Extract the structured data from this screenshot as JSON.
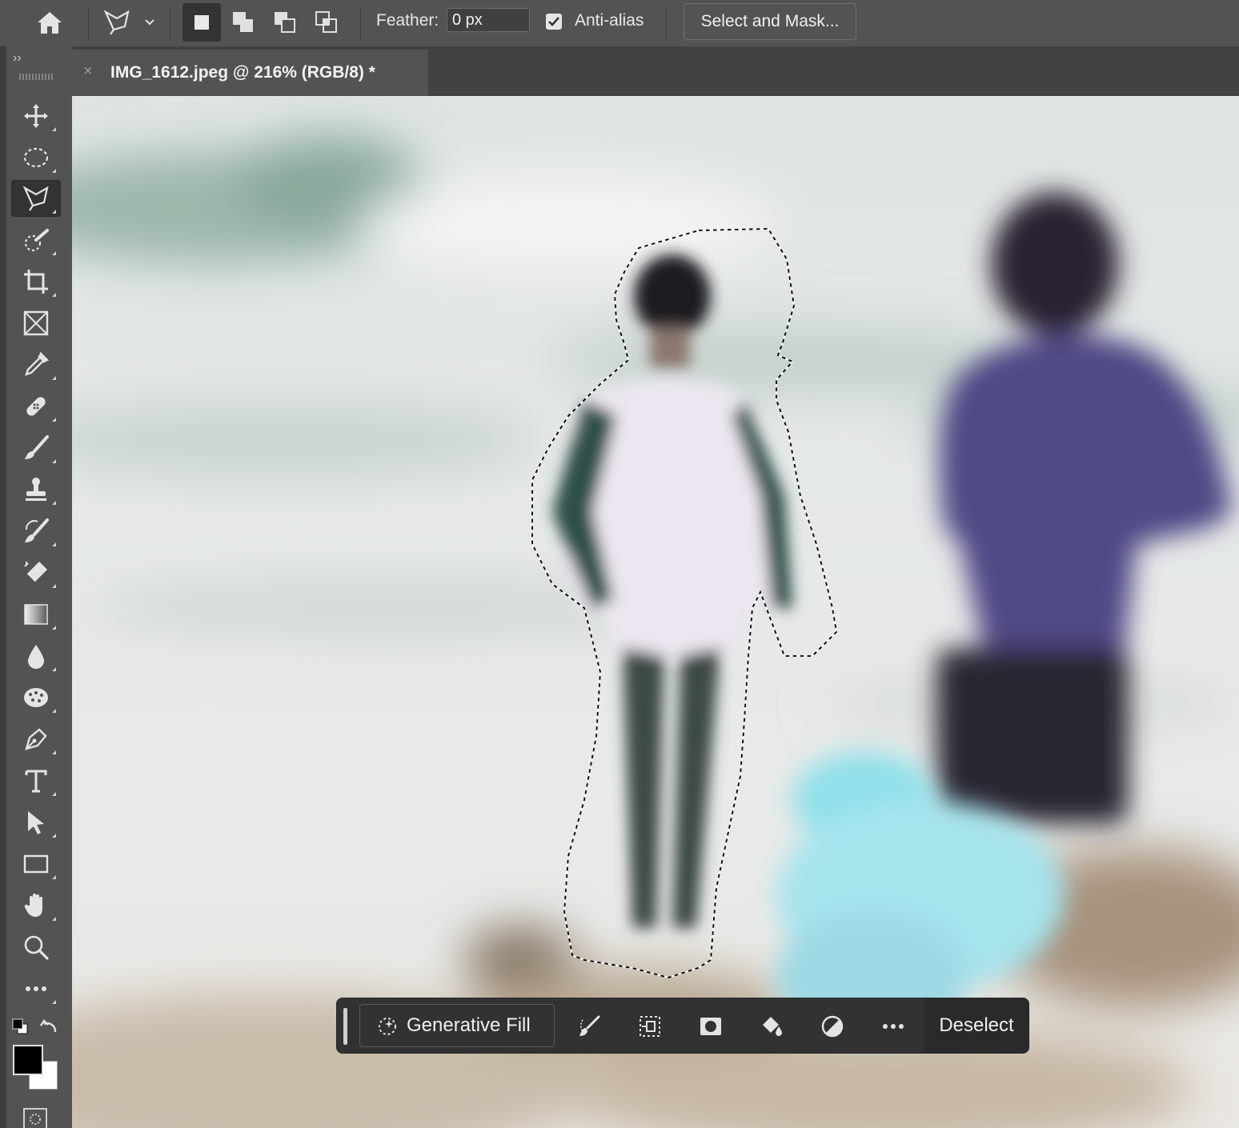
{
  "options_bar": {
    "feather_label": "Feather:",
    "feather_value": "0 px",
    "anti_alias_label": "Anti-alias",
    "anti_alias_checked": true,
    "select_and_mask_label": "Select and Mask..."
  },
  "document_tab": {
    "title": "IMG_1612.jpeg @ 216% (RGB/8) *",
    "close_glyph": "×"
  },
  "tools_panel": {
    "collapse_glyph": "››",
    "tools": [
      {
        "name": "move-tool",
        "icon": "move-icon"
      },
      {
        "name": "elliptical-marquee-tool",
        "icon": "ellipse-marquee-icon"
      },
      {
        "name": "polygonal-lasso-tool",
        "icon": "polygonal-lasso-icon",
        "active": true
      },
      {
        "name": "quick-selection-tool",
        "icon": "quick-selection-icon"
      },
      {
        "name": "crop-tool",
        "icon": "crop-icon"
      },
      {
        "name": "frame-tool",
        "icon": "frame-icon"
      },
      {
        "name": "eyedropper-tool",
        "icon": "eyedropper-icon"
      },
      {
        "name": "healing-brush-tool",
        "icon": "bandage-icon"
      },
      {
        "name": "brush-tool",
        "icon": "brush-icon"
      },
      {
        "name": "clone-stamp-tool",
        "icon": "stamp-icon"
      },
      {
        "name": "history-brush-tool",
        "icon": "history-brush-icon"
      },
      {
        "name": "eraser-tool",
        "icon": "eraser-icon"
      },
      {
        "name": "gradient-tool",
        "icon": "gradient-icon"
      },
      {
        "name": "blur-tool",
        "icon": "drop-icon"
      },
      {
        "name": "sponge-tool",
        "icon": "sponge-icon"
      },
      {
        "name": "pen-tool",
        "icon": "pen-icon"
      },
      {
        "name": "type-tool",
        "icon": "type-icon"
      },
      {
        "name": "path-selection-tool",
        "icon": "arrow-icon"
      },
      {
        "name": "rectangle-tool",
        "icon": "rectangle-icon"
      },
      {
        "name": "hand-tool",
        "icon": "hand-icon"
      },
      {
        "name": "zoom-tool",
        "icon": "magnifier-icon"
      },
      {
        "name": "edit-toolbar",
        "icon": "more-icon"
      }
    ],
    "foreground_color": "#000000",
    "background_color": "#ffffff"
  },
  "contextual_taskbar": {
    "generative_fill_label": "Generative Fill",
    "deselect_label": "Deselect",
    "icons": [
      "modify-brush-icon",
      "transform-selection-icon",
      "mask-icon",
      "fill-bucket-icon",
      "adjustment-icon",
      "more-icon"
    ]
  },
  "colors": {
    "panel": "#535353",
    "canvas_sky": "#e6e8e6",
    "taskbar": "#323232"
  }
}
